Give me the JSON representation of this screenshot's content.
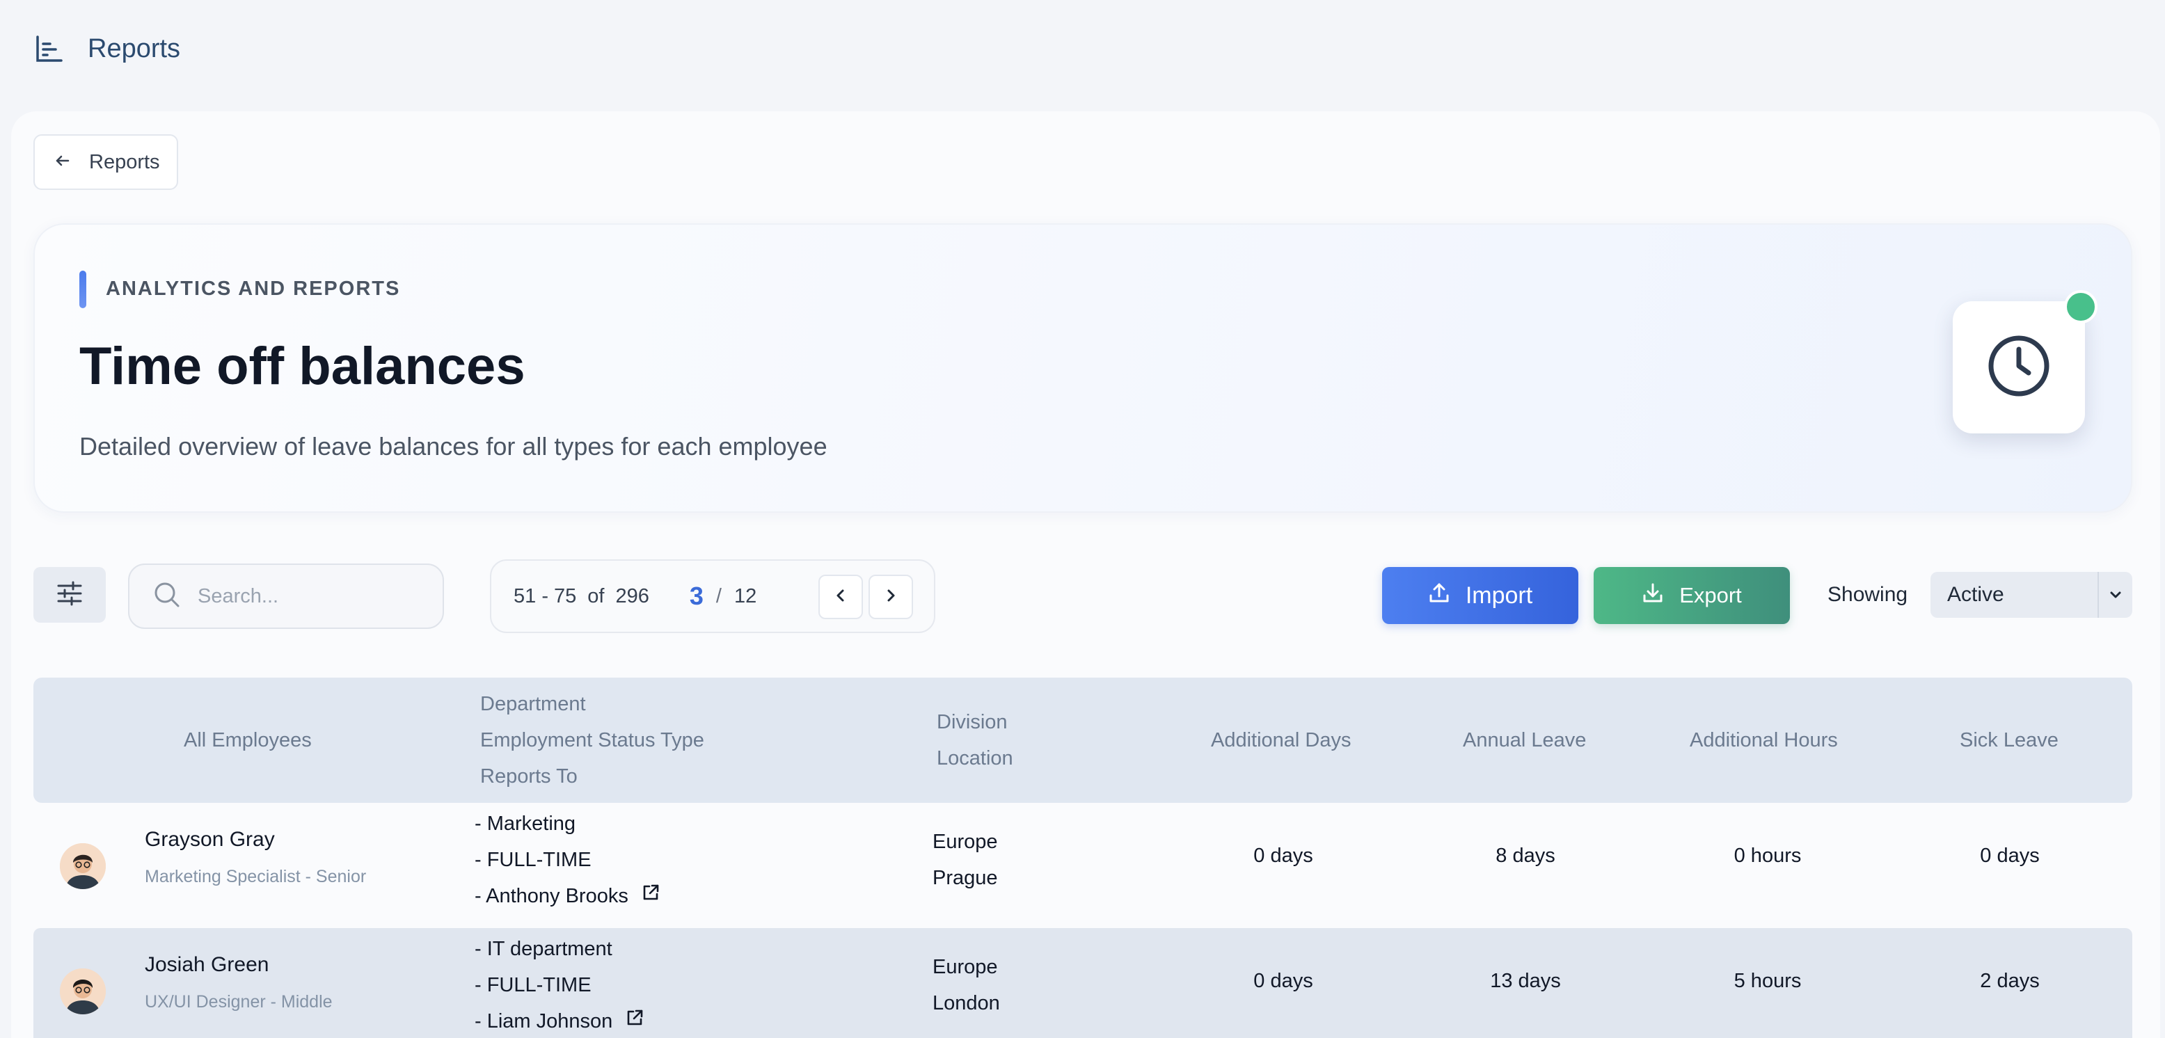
{
  "header": {
    "title": "Reports"
  },
  "back_button": {
    "label": "Reports"
  },
  "hero": {
    "eyebrow": "ANALYTICS AND REPORTS",
    "title": "Time off balances",
    "description": "Detailed overview of leave balances for all types for each employee",
    "icon": "clock-icon",
    "status_color": "#48c08b"
  },
  "toolbar": {
    "search_placeholder": "Search...",
    "pager": {
      "range": "51 - 75",
      "of": "of",
      "total": "296",
      "current_page": "3",
      "slash": "/",
      "page_count": "12"
    },
    "import_label": "Import",
    "export_label": "Export",
    "showing_label": "Showing",
    "status_select": "Active"
  },
  "colors": {
    "accent_blue": "#3b6bd8",
    "export_green": "#4eb887",
    "table_header": "#e0e7f1"
  },
  "table": {
    "headers": {
      "employees": "All Employees",
      "department": "Department",
      "employment_status": "Employment Status Type",
      "reports_to": "Reports To",
      "division": "Division",
      "location": "Location",
      "additional_days": "Additional Days",
      "annual_leave": "Annual Leave",
      "additional_hours": "Additional Hours",
      "sick_leave": "Sick Leave"
    },
    "rows": [
      {
        "name": "Grayson Gray",
        "role": "Marketing Specialist - Senior",
        "department": "- Marketing",
        "status": "- FULL-TIME",
        "reports_to": "- Anthony Brooks",
        "division": "Europe",
        "location": "Prague",
        "additional_days": "0 days",
        "annual_leave": "8 days",
        "additional_hours": "0 hours",
        "sick_leave": "0 days"
      },
      {
        "name": "Josiah Green",
        "role": "UX/UI Designer - Middle",
        "department": "- IT department",
        "status": "- FULL-TIME",
        "reports_to": "- Liam Johnson",
        "division": "Europe",
        "location": "London",
        "additional_days": "0 days",
        "annual_leave": "13 days",
        "additional_hours": "5 hours",
        "sick_leave": "2 days"
      }
    ]
  }
}
